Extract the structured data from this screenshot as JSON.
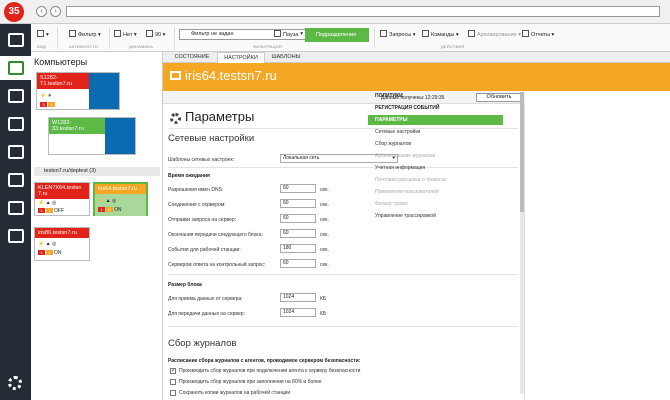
{
  "app": {
    "badge": "35"
  },
  "toolbar": {
    "filter": "Фильтр",
    "filter_group": "АКТИВНОСТИ",
    "view_group": "ВИД",
    "no": "Нет",
    "zoom": "90",
    "dyn_group": "ДИНАМИКА",
    "filter_select": "Фильтр не задан",
    "pause": "Пауза",
    "subdivision": "Подразделения",
    "filt_group": "ФИЛЬТРАЦИЯ",
    "requests": "Запросы",
    "commands": "Команды",
    "archiving": "Архивирование",
    "reports": "Отчеты",
    "actions_group": "ДЕЙСТВИЯ"
  },
  "computers": {
    "title": "Компьютеры",
    "tiles": [
      {
        "name1": "S1282-",
        "name2": "T1.testsn7.ru",
        "head_color": "#e2231a",
        "stat_color": "#0b6bb0"
      },
      {
        "name1": "W1282-",
        "name2": "33.testsn7.ru",
        "head_color": "#5db946",
        "stat_color": "#0b6bb0"
      },
      {
        "name1": "KLEN7X64.testsn",
        "name2": "7.ru",
        "head_color": "#e2231a",
        "stat_color": "#fff",
        "status": "OFF"
      },
      {
        "name1": "iris64.testsn7.ru",
        "name2": "",
        "head_color": "#f5a623",
        "stat_color": "#5db946",
        "status": "ON"
      },
      {
        "name1": "iris86.testsn7.ru",
        "name2": "",
        "head_color": "#e2231a",
        "stat_color": "#fff",
        "status": "ON"
      }
    ],
    "group": "testsn7.ru/deptest (3)",
    "counts": [
      "3",
      "1",
      "1",
      "1",
      "1",
      "0"
    ]
  },
  "tabs": [
    "СОСТОЯНИЕ",
    "НАСТРОЙКИ",
    "ШАБЛОНЫ"
  ],
  "host": "iris64.testsn7.ru",
  "info": {
    "received_label": "Данные получены:",
    "received_time": "12:29:35",
    "refresh": "Обновить"
  },
  "params": {
    "title": "Параметры",
    "net_title": "Сетевые настройки",
    "templates_label": "Шаблоны сетевых настроек:",
    "templates_value": "Локальная сеть",
    "wait_title": "Время ожидания",
    "wait_rows": [
      {
        "label": "Разрешения имен DNS:",
        "value": "60",
        "unit": "сек."
      },
      {
        "label": "Соединения с сервером:",
        "value": "60",
        "unit": "сек."
      },
      {
        "label": "Отправки запроса на сервер:",
        "value": "60",
        "unit": "сек."
      },
      {
        "label": "Окончания передачи следующего блока:",
        "value": "60",
        "unit": "сек."
      },
      {
        "label": "События для рабочей станции:",
        "value": "180",
        "unit": "сек."
      },
      {
        "label": "Сервером ответа на контрольный запрос:",
        "value": "60",
        "unit": "сек."
      }
    ],
    "block_title": "Размер блока",
    "block_rows": [
      {
        "label": "Для приема данных от сервера:",
        "value": "1024",
        "unit": "КБ"
      },
      {
        "label": "Для передачи данных на сервер:",
        "value": "1024",
        "unit": "КБ"
      }
    ],
    "logs_title": "Сбор журналов",
    "logs_sub": "Расписание сбора журналов с агентов, проводимое сервером безопасности:",
    "logs_checks": [
      {
        "label": "Производить сбор журналов при подключении агента к серверу безопасности",
        "checked": true
      },
      {
        "label": "Производить сбор журналов при заполнении на 80% и более",
        "checked": false
      },
      {
        "label": "Сохранять копии журналов на рабочей станции",
        "checked": false
      }
    ]
  },
  "menu": [
    {
      "label": "ПОЛИТИКИ",
      "kind": "head"
    },
    {
      "label": "РЕГИСТРАЦИЯ СОБЫТИЙ",
      "kind": "head"
    },
    {
      "label": "ПАРАМЕТРЫ",
      "kind": "active"
    },
    {
      "label": "Сетевые настройки",
      "kind": "sub"
    },
    {
      "label": "Сбор журналов",
      "kind": "sub"
    },
    {
      "label": "Архивирование журналов",
      "kind": "dis"
    },
    {
      "label": "Учетная информация",
      "kind": "sub"
    },
    {
      "label": "Почтовая рассылка о тревогах",
      "kind": "dis"
    },
    {
      "label": "Привилегии пользователей",
      "kind": "dis"
    },
    {
      "label": "Фильтр тревог",
      "kind": "dis"
    },
    {
      "label": "Управление трассировкой",
      "kind": "sub"
    }
  ]
}
